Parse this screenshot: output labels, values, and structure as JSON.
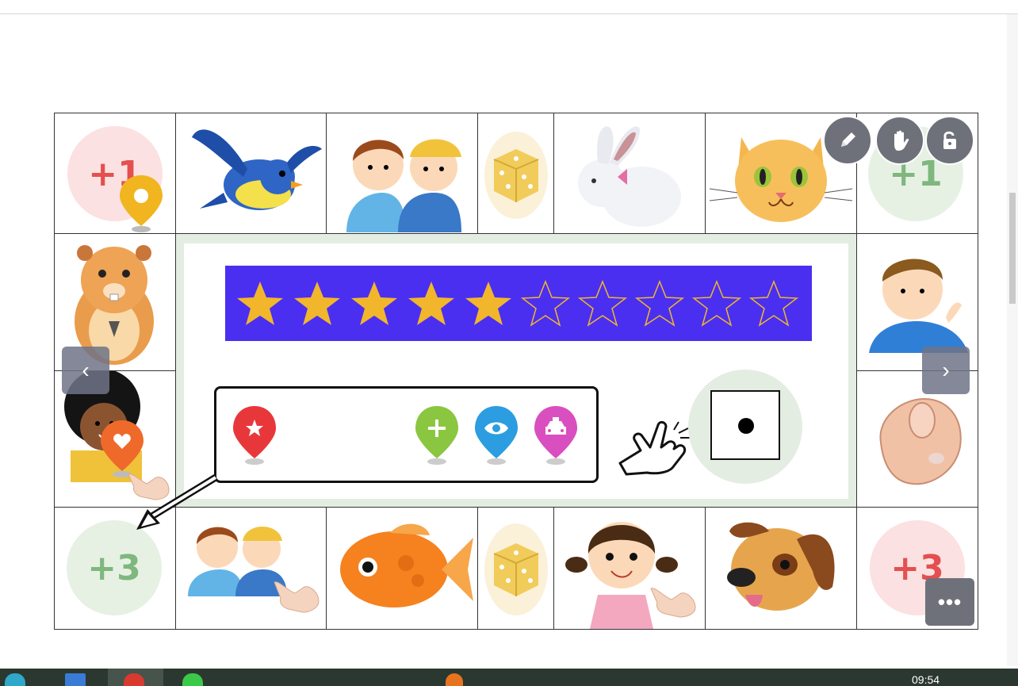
{
  "board": {
    "top_row": [
      {
        "name": "cell-bonus-plus1-red",
        "bonus": "+1",
        "color": "#e4504f"
      },
      {
        "name": "cell-bird",
        "icon": "bird-icon"
      },
      {
        "name": "cell-two-boys",
        "icon": "two-boys-icon"
      },
      {
        "name": "cell-dice",
        "icon": "dice-icon"
      },
      {
        "name": "cell-rabbit",
        "icon": "rabbit-icon"
      },
      {
        "name": "cell-cat",
        "icon": "cat-icon"
      },
      {
        "name": "cell-bonus-plus1-green",
        "bonus": "+1",
        "color": "#7fb77e"
      }
    ],
    "bottom_row": [
      {
        "name": "cell-bonus-plus3-green",
        "bonus": "+3",
        "color": "#7fb77e"
      },
      {
        "name": "cell-two-boys-pointing",
        "icon": "two-boys-icon"
      },
      {
        "name": "cell-goldfish",
        "icon": "goldfish-icon"
      },
      {
        "name": "cell-dice-bottom",
        "icon": "dice-icon"
      },
      {
        "name": "cell-girl",
        "icon": "girl-icon"
      },
      {
        "name": "cell-dog",
        "icon": "dog-icon"
      },
      {
        "name": "cell-bonus-plus3-red",
        "bonus": "+3",
        "color": "#e4504f"
      }
    ],
    "left_col": [
      "hamster-icon",
      "curly-hair-kid-icon"
    ],
    "right_col": [
      "thinking-boy-icon",
      "pointing-hand-icon"
    ]
  },
  "progress": {
    "filled_stars": 5,
    "total_stars": 10,
    "bar_color": "#4a2ff0",
    "star_color": "#f2b62c"
  },
  "tokens": [
    {
      "name": "red-star-token",
      "color": "#e8373b",
      "glyph": "★"
    },
    {
      "name": "green-plus-token",
      "color": "#8ac640",
      "glyph": "+"
    },
    {
      "name": "blue-eye-token",
      "color": "#2c9de0",
      "glyph": "◉"
    },
    {
      "name": "pink-car-token",
      "color": "#d94fbf",
      "glyph": "🚕"
    }
  ],
  "die": {
    "value": 1
  },
  "toolbar": {
    "edit_icon": "pencil-icon",
    "pan_icon": "hand-icon",
    "unlock_icon": "unlock-icon",
    "more_label": "•••"
  },
  "nav": {
    "prev": "‹",
    "next": "›"
  },
  "taskbar": {
    "clock": "09:54"
  }
}
